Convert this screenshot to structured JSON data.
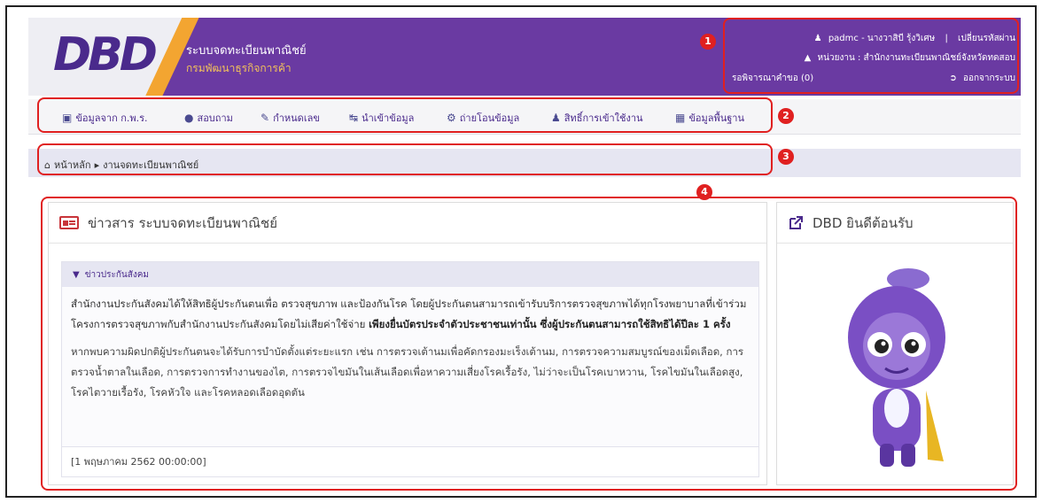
{
  "header": {
    "logo": "DBD",
    "app_title": "ระบบจดทะเบียนพาณิชย์",
    "app_subtitle": "กรมพัฒนาธุรกิจการค้า",
    "user_name": "padmc - นางวาสิบี รุ้งวิเศษ",
    "change_password": "เปลี่ยนรหัสผ่าน",
    "separator": "|",
    "agency": "หน่วยงาน : สำนักงานทะเบียนพาณิชย์จังหวัดทดสอบ",
    "pending": "รอพิจารณาคำขอ (0)",
    "logout": "ออกจากระบบ"
  },
  "nav": [
    {
      "label": "ข้อมูลจาก ก.พ.ร.",
      "icon": "monitor-icon"
    },
    {
      "label": "สอบถาม",
      "icon": "chat-icon"
    },
    {
      "label": "กำหนดเลข",
      "icon": "edit-icon"
    },
    {
      "label": "นำเข้าข้อมูล",
      "icon": "import-icon"
    },
    {
      "label": "ถ่ายโอนข้อมูล",
      "icon": "gear-icon"
    },
    {
      "label": "สิทธิ์การเข้าใช้งาน",
      "icon": "user-icon"
    },
    {
      "label": "ข้อมูลพื้นฐาน",
      "icon": "table-icon"
    }
  ],
  "breadcrumb": {
    "home": "หน้าหลัก",
    "current": "งานจดทะเบียนพาณิชย์"
  },
  "news": {
    "title": "ข่าวสาร ระบบจดทะเบียนพาณิชย์",
    "category": "ข่าวประกันสังคม",
    "para1_normal": "สำนักงานประกันสังคมได้ให้สิทธิผู้ประกันตนเพื่อ ตรวจสุขภาพ และป้องกันโรค โดยผู้ประกันตนสามารถเข้ารับบริการตรวจสุขภาพได้ทุกโรงพยาบาลที่เข้าร่วมโครงการตรวจสุขภาพกับสำนักงานประกันสังคมโดยไม่เสียค่าใช้จ่าย",
    "para1_bold": "เพียงยื่นบัตรประจำตัวประชาชนเท่านั้น ซึ่งผู้ประกันตนสามารถใช้สิทธิได้ปีละ 1 ครั้ง",
    "para2": "หากพบความผิดปกติผู้ประกันตนจะได้รับการบำบัดตั้งแต่ระยะแรก เช่น การตรวจเต้านมเพื่อคัดกรองมะเร็งเต้านม, การตรวจความสมบูรณ์ของเม็ดเลือด, การตรวจน้ำตาลในเลือด, การตรวจการทำงานของไต, การตรวจไขมันในเส้นเลือดเพื่อหาความเสี่ยงโรคเรื้อรัง, ไม่ว่าจะเป็นโรคเบาหวาน, โรคไขมันในเลือดสูง, โรคไตวายเรื้อรัง, โรคหัวใจ และโรคหลอดเลือดอุดตัน",
    "date": "[1 พฤษภาคม 2562 00:00:00]"
  },
  "welcome": {
    "title": "DBD ยินดีต้อนรับ"
  },
  "annotations": [
    "1",
    "2",
    "3",
    "4"
  ],
  "colors": {
    "brand_purple": "#6a3aa2",
    "brand_orange": "#f3a531",
    "annotation_red": "#e02020"
  }
}
